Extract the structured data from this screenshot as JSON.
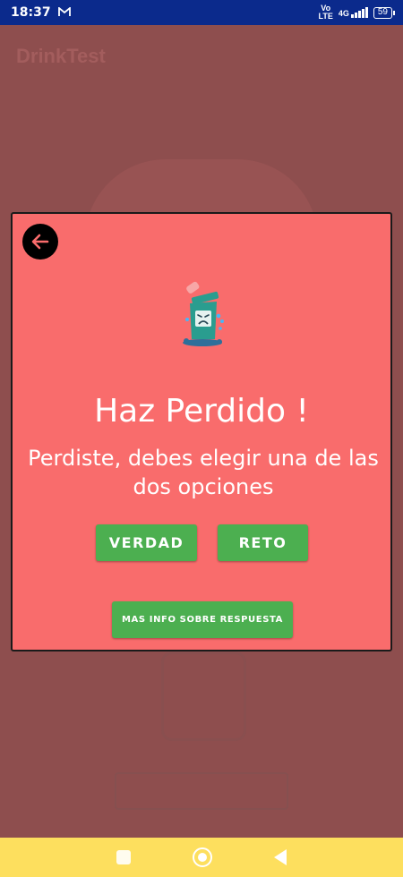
{
  "status_bar": {
    "time": "18:37",
    "network_top": "Vo",
    "network_bottom": "LTE",
    "network_type": "4G",
    "battery": "59"
  },
  "background_app": {
    "title": "DrinkTest"
  },
  "dialog": {
    "title": "Haz Perdido !",
    "message": "Perdiste, debes elegir una de las dos opciones",
    "truth_button": "VERDAD",
    "dare_button": "RETO",
    "info_button": "MAS INFO SOBRE RESPUESTA",
    "back_icon": "arrow-left-icon",
    "illustration_icon": "crying-trash-can-icon"
  },
  "colors": {
    "dialog_bg": "#f96c6c",
    "button_green": "#4caf50",
    "status_bar": "#0b2a8c",
    "nav_bar": "#fddf5e",
    "overlay": "#8e4e4e",
    "back_arrow": "#f96c6c"
  }
}
